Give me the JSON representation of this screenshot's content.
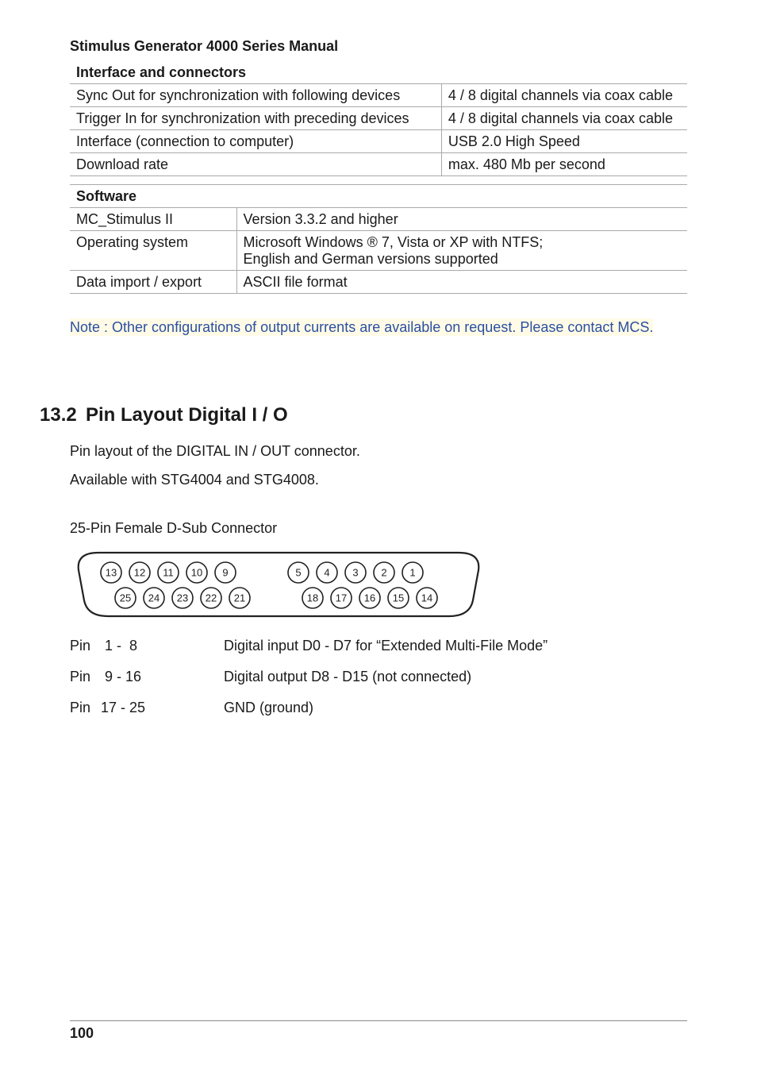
{
  "doc_title": "Stimulus Generator 4000 Series Manual",
  "tables": {
    "interface": {
      "header": "Interface and connectors",
      "rows": [
        {
          "left": "Sync Out for synchronization with following devices",
          "right": "4 / 8 digital channels via coax cable"
        },
        {
          "left": "Trigger In for synchronization with preceding devices",
          "right": "4 / 8 digital channels via coax cable"
        },
        {
          "left": "Interface (connection to computer)",
          "right": "USB 2.0 High Speed"
        },
        {
          "left": "Download rate",
          "right": "max. 480 Mb per second"
        }
      ]
    },
    "software": {
      "header": "Software",
      "rows": [
        {
          "left": "MC_Stimulus II",
          "right": "Version 3.3.2 and higher"
        },
        {
          "left": "Operating system",
          "right": "Microsoft Windows ® 7, Vista or XP with NTFS;\nEnglish and German versions supported"
        },
        {
          "left": "Data import / export",
          "right": "ASCII file format"
        }
      ]
    }
  },
  "note": "Note : Other configurations of output currents are available on request. Please contact MCS.",
  "section": {
    "num": "13.2",
    "title": "Pin Layout Digital I / O"
  },
  "paras": {
    "p1": "Pin layout of the DIGITAL IN / OUT connector.",
    "p2": "Available with STG4004 and STG4008.",
    "p3": "25-Pin Female D-Sub Connector"
  },
  "connector": {
    "top": [
      "13",
      "12",
      "11",
      "10",
      "9",
      "5",
      "4",
      "3",
      "2",
      "1"
    ],
    "bottom": [
      "25",
      "24",
      "23",
      "22",
      "21",
      "18",
      "17",
      "16",
      "15",
      "14"
    ]
  },
  "pins": [
    {
      "label": "Pin",
      "range": "  1 -  8",
      "desc": "Digital input D0 - D7 for “Extended Multi-File Mode”"
    },
    {
      "label": "Pin",
      "range": "  9 - 16",
      "desc": "Digital output D8 - D15 (not connected)"
    },
    {
      "label": "Pin",
      "range": " 17 - 25",
      "desc": "GND (ground)"
    }
  ],
  "page_number": "100"
}
